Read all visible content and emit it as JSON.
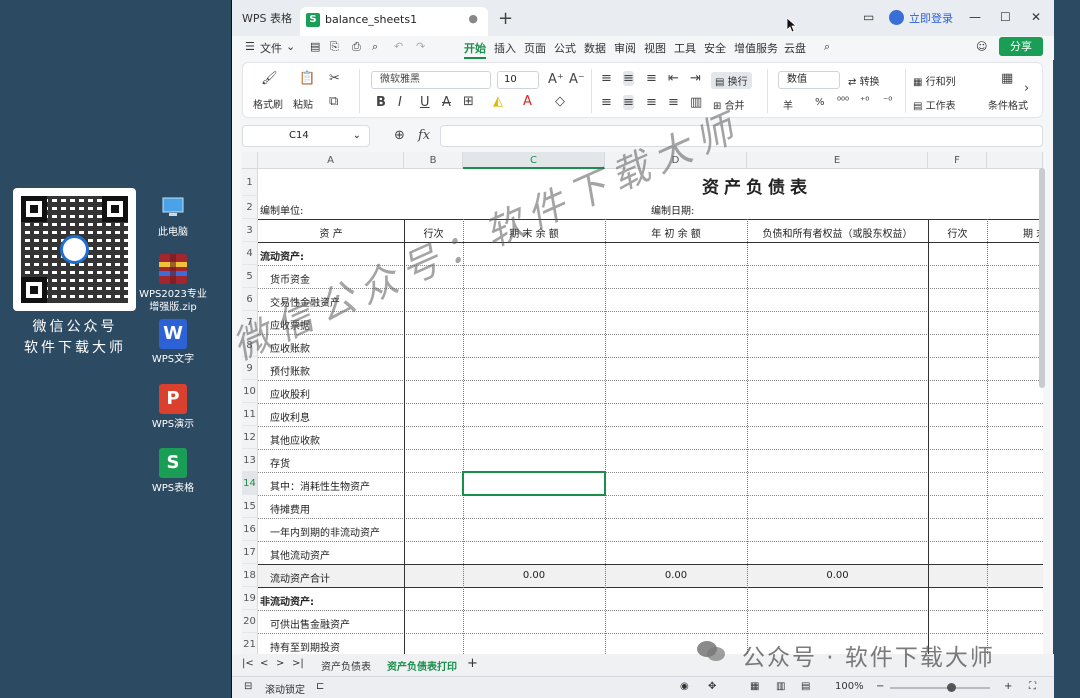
{
  "desktop": {
    "qr_caption_line1": "微信公众号",
    "qr_caption_line2": "软件下载大师",
    "icons": [
      {
        "label": "此电脑",
        "icon": "computer-icon"
      },
      {
        "label": "WPS2023专业增强版.zip",
        "icon": "zip-archive-icon"
      },
      {
        "label": "WPS文字",
        "icon": "wps-writer-icon"
      },
      {
        "label": "WPS演示",
        "icon": "wps-presentation-icon"
      },
      {
        "label": "WPS表格",
        "icon": "wps-spreadsheet-icon"
      }
    ]
  },
  "titlebar": {
    "home_tab": "WPS 表格",
    "doc_tab": "balance_sheets1",
    "login": "立即登录"
  },
  "menu": {
    "file": "文件",
    "items": [
      "开始",
      "插入",
      "页面",
      "公式",
      "数据",
      "审阅",
      "视图",
      "工具",
      "安全",
      "增值服务",
      "云盘"
    ],
    "share": "分享"
  },
  "ribbon": {
    "format_painter": "格式刷",
    "paste": "粘贴",
    "font_name": "微软雅黑",
    "font_size": "10",
    "wrap": "换行",
    "merge": "合并",
    "number_format": "数值",
    "convert": "转换",
    "row_col": "行和列",
    "worksheet": "工作表",
    "conditional": "条件格式",
    "currency": "羊",
    "percent": "%"
  },
  "formula": {
    "cell_ref": "C14",
    "fx": "fx"
  },
  "grid": {
    "columns": [
      "A",
      "B",
      "C",
      "D",
      "E",
      "F"
    ],
    "selected_column": "C",
    "selected_row": "14",
    "title": "资产负债表",
    "unit_label": "编制单位:",
    "date_label": "编制日期:",
    "headers": [
      "资 产",
      "行次",
      "期 末 余 额",
      "年 初 余 额",
      "负债和所有者权益（或股东权益）",
      "行次",
      "期 末"
    ],
    "rows": [
      {
        "num": "1",
        "a": ""
      },
      {
        "num": "2",
        "a": ""
      },
      {
        "num": "3",
        "a": ""
      },
      {
        "num": "4",
        "a": "流动资产:"
      },
      {
        "num": "5",
        "a": "货币资金"
      },
      {
        "num": "6",
        "a": "交易性金融资产"
      },
      {
        "num": "7",
        "a": "应收票据"
      },
      {
        "num": "8",
        "a": "应收账款"
      },
      {
        "num": "9",
        "a": "预付账款"
      },
      {
        "num": "10",
        "a": "应收股利"
      },
      {
        "num": "11",
        "a": "应收利息"
      },
      {
        "num": "12",
        "a": "其他应收款"
      },
      {
        "num": "13",
        "a": "存货"
      },
      {
        "num": "14",
        "a": "其中：消耗性生物资产"
      },
      {
        "num": "15",
        "a": "待摊费用"
      },
      {
        "num": "16",
        "a": "一年内到期的非流动资产"
      },
      {
        "num": "17",
        "a": "其他流动资产"
      },
      {
        "num": "18",
        "a": "流动资产合计"
      },
      {
        "num": "19",
        "a": "非流动资产:"
      },
      {
        "num": "20",
        "a": "可供出售金融资产"
      },
      {
        "num": "21",
        "a": "持有至到期投资"
      }
    ],
    "total_values": [
      "0.00",
      "0.00",
      "0.00"
    ]
  },
  "sheets": [
    "资产负债表",
    "资产负债表打印"
  ],
  "active_sheet": "资产负债表打印",
  "status": {
    "scroll_lock": "滚动锁定",
    "zoom": "100%"
  },
  "watermarks": {
    "diagonal": "微信公众号：软件下载大师",
    "corner": "公众号 · 软件下载大师"
  },
  "colors": {
    "accent": "#1a8f4c",
    "desktop": "#2d4a63",
    "link": "#2c62d6"
  }
}
